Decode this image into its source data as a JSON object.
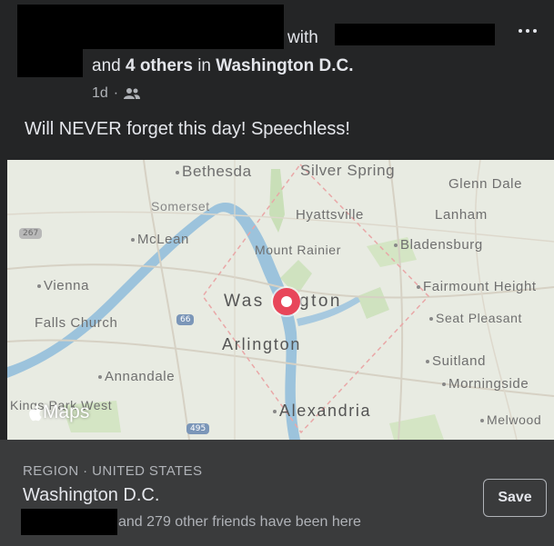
{
  "post": {
    "header": {
      "with_text": "with",
      "and_text": "and",
      "others_text": "4 others",
      "in_text": "in",
      "location": "Washington D.C.",
      "timestamp": "1d",
      "separator": "·",
      "audience_icon": "friends-icon"
    },
    "more_icon": "more-icon",
    "text": "Will NEVER forget this day! Speechless!"
  },
  "map": {
    "provider_label": "Maps",
    "provider_icon": "apple-icon",
    "pin_color": "#e8465a",
    "labels": {
      "bethesda": "Bethesda",
      "silver_spring": "Silver Spring",
      "glenn_dale": "Glenn Dale",
      "somerset": "Somerset",
      "hyattsville": "Hyattsville",
      "lanham": "Lanham",
      "mclean": "McLean",
      "mount_rainier": "Mount Rainier",
      "bladensburg": "Bladensburg",
      "vienna": "Vienna",
      "fairmount_heights": "Fairmount Height",
      "falls_church": "Falls Church",
      "washington_left": "Was",
      "washington_right": "gton",
      "seat_pleasant": "Seat Pleasant",
      "arlington": "Arlington",
      "suitland": "Suitland",
      "annandale": "Annandale",
      "morningside": "Morningside",
      "kings_park_west": "Kings Park West",
      "alexandria": "Alexandria",
      "melwood": "Melwood",
      "shield_267": "267",
      "shield_66": "66",
      "shield_495": "495"
    }
  },
  "footer": {
    "region": "REGION · UNITED STATES",
    "place": "Washington D.C.",
    "visited": "and 279 other friends have been here",
    "save_label": "Save"
  }
}
